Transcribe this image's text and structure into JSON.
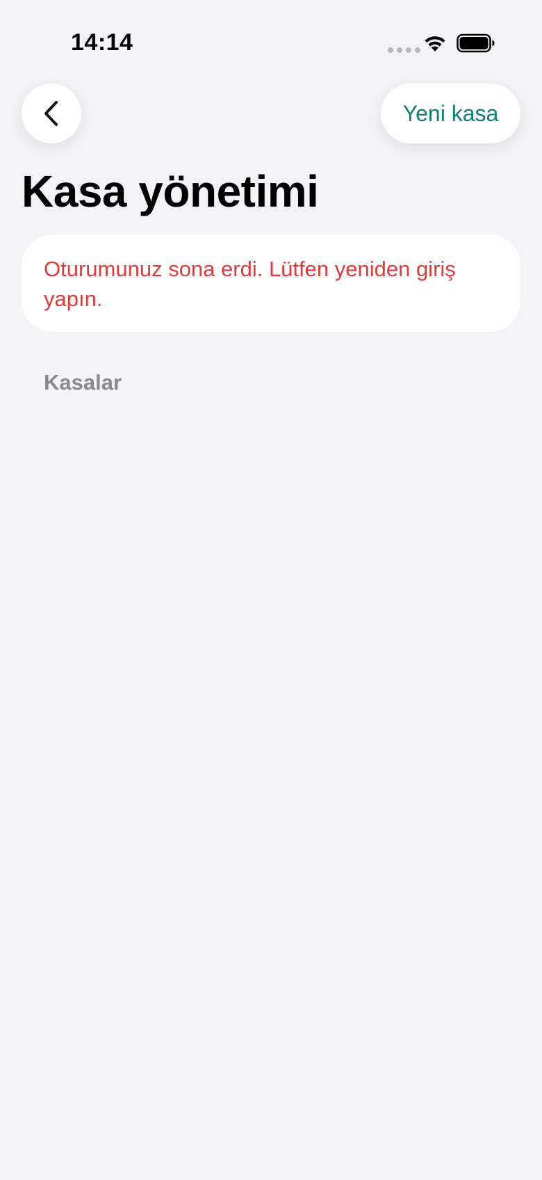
{
  "status_bar": {
    "time": "14:14"
  },
  "header": {
    "back_icon": "chevron-left-icon",
    "new_vault_label": "Yeni kasa"
  },
  "page": {
    "title": "Kasa yönetimi"
  },
  "error": {
    "message": "Oturumunuz sona erdi. Lütfen yeniden giriş yapın."
  },
  "vaults": {
    "section_label": "Kasalar",
    "items": []
  },
  "colors": {
    "background": "#f2f2f7",
    "accent": "#0f7f6e",
    "error": "#e5383b",
    "secondary_text": "#8a8a8e"
  }
}
